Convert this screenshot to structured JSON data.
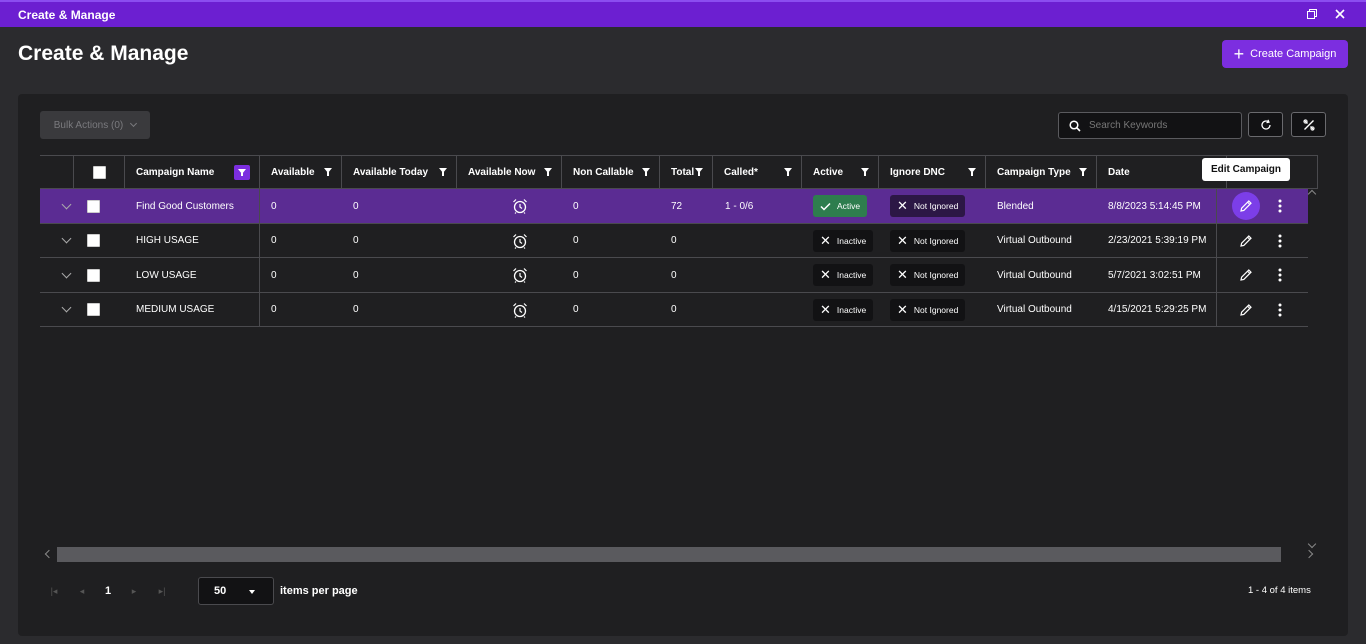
{
  "window": {
    "title": "Create & Manage",
    "restore_icon": "restore-icon",
    "close_icon": "close-icon"
  },
  "page": {
    "title": "Create & Manage",
    "create_button": "Create Campaign"
  },
  "toolbar": {
    "bulk_actions": "Bulk Actions (0)",
    "search_placeholder": "Search Keywords"
  },
  "columns": [
    "Campaign Name",
    "Available",
    "Available Today",
    "Available Now",
    "Non Callable",
    "Total",
    "Called*",
    "Active",
    "Ignore DNC",
    "Campaign Type",
    "Date"
  ],
  "rows": [
    {
      "name": "Find Good Customers",
      "available": "0",
      "available_today": "0",
      "non_callable": "0",
      "total": "72",
      "called": "1 - 0/6",
      "active": "Active",
      "ignore_dnc": "Not Ignored",
      "type": "Blended",
      "date": "8/8/2023 5:14:45 PM",
      "selected": true
    },
    {
      "name": "HIGH USAGE",
      "available": "0",
      "available_today": "0",
      "non_callable": "0",
      "total": "0",
      "called": "",
      "active": "Inactive",
      "ignore_dnc": "Not Ignored",
      "type": "Virtual Outbound",
      "date": "2/23/2021 5:39:19 PM",
      "selected": false
    },
    {
      "name": "LOW USAGE",
      "available": "0",
      "available_today": "0",
      "non_callable": "0",
      "total": "0",
      "called": "",
      "active": "Inactive",
      "ignore_dnc": "Not Ignored",
      "type": "Virtual Outbound",
      "date": "5/7/2021 3:02:51 PM",
      "selected": false
    },
    {
      "name": "MEDIUM USAGE",
      "available": "0",
      "available_today": "0",
      "non_callable": "0",
      "total": "0",
      "called": "",
      "active": "Inactive",
      "ignore_dnc": "Not Ignored",
      "type": "Virtual Outbound",
      "date": "4/15/2021 5:29:25 PM",
      "selected": false
    }
  ],
  "tooltip": "Edit Campaign",
  "pager": {
    "current_page": "1",
    "page_size": "50",
    "per_page_label": "items per page",
    "count": "1 - 4 of 4 items"
  },
  "colors": {
    "accent": "#7c2ee0",
    "titlebar": "#6c1fd1",
    "selected_row": "#5b2c93",
    "active_badge": "#2e7d4e"
  }
}
